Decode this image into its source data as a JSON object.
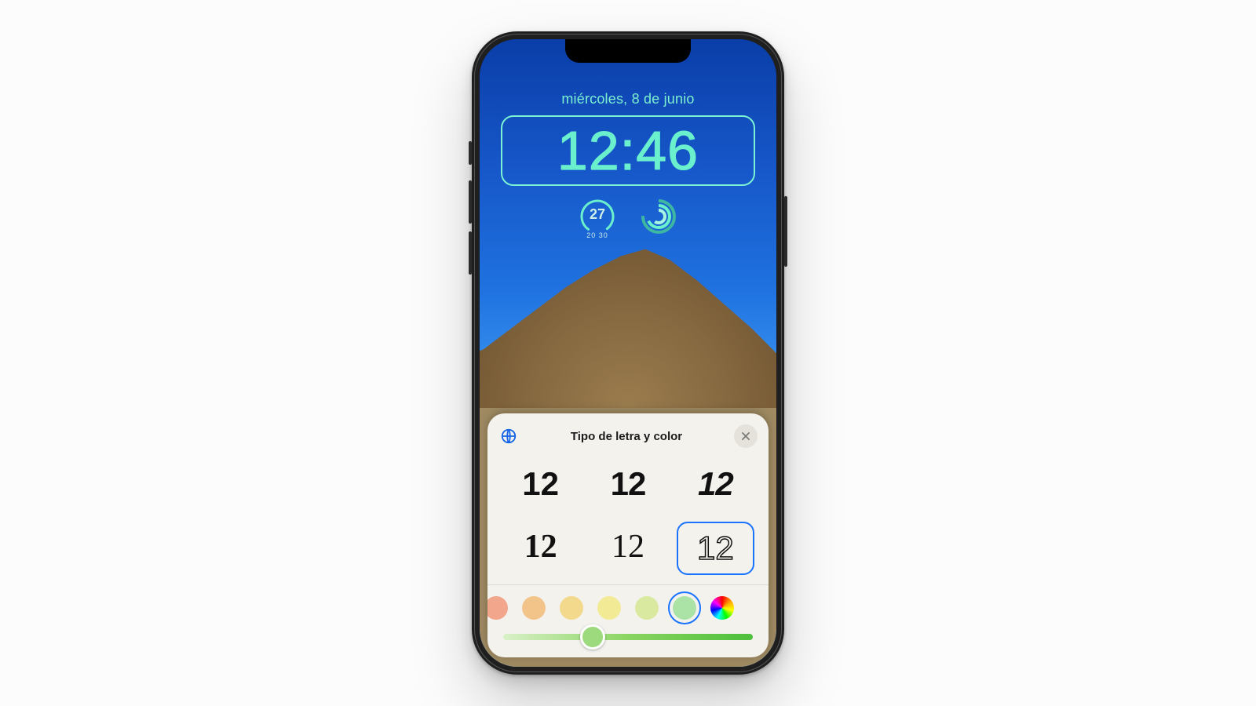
{
  "lockscreen": {
    "date": "miércoles, 8 de junio",
    "time": "12:46",
    "accent_color": "#6af0cc",
    "weather": {
      "temp": "27",
      "range": "20 30"
    }
  },
  "card": {
    "title": "Tipo de letra y color",
    "sample": "12",
    "selected_font_index": 5,
    "swatches": [
      "#f2a68c",
      "#f3c48a",
      "#f3d98b",
      "#f2ea95",
      "#d9eaa0",
      "#abe2a6"
    ],
    "selected_swatch_index": 5,
    "slider_percent": 36
  }
}
